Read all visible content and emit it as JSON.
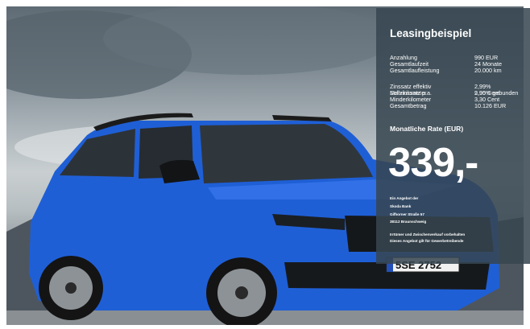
{
  "image": {
    "alt": "Skoda Kodiaq RS blue SUV"
  },
  "car": {
    "plate": "5SE 2752"
  },
  "leasing": {
    "title": "Leasingbeispiel",
    "rows": [
      {
        "label": "Anzahlung",
        "value": "990 EUR"
      },
      {
        "label": "Gesamtlaufzeit",
        "value": "24 Monate"
      },
      {
        "label": "Gesamtlaufleistung",
        "value": "20.000 km"
      },
      {
        "label": "Zinssatz effektiv",
        "value": "2,99%"
      },
      {
        "label": "Sollzinssatz p.a.",
        "value": "2,95% gebunden",
        "overlay_label": "Mehrkilometer",
        "overlay_value": "9,90 Cent"
      },
      {
        "label": "Minderkilometer",
        "value": "3,30 Cent"
      },
      {
        "label": "Gesamtbetrag",
        "value": "10.126 EUR"
      }
    ],
    "rate_label": "Monatliche Rate (EUR)",
    "rate": "339,-",
    "provider_lines": [
      "Ein Angebot der",
      "Skoda Bank",
      "Gifhorner Straße 57",
      "38112 Braunschweig"
    ],
    "disclaimer_lines": [
      "Irrtümer und Zwischenverkauf vorbehalten",
      "Dieses Angebot gilt für Gewerbetreibende"
    ]
  },
  "colors": {
    "panel": "#37464f",
    "car_body": "#1f5fd6"
  }
}
